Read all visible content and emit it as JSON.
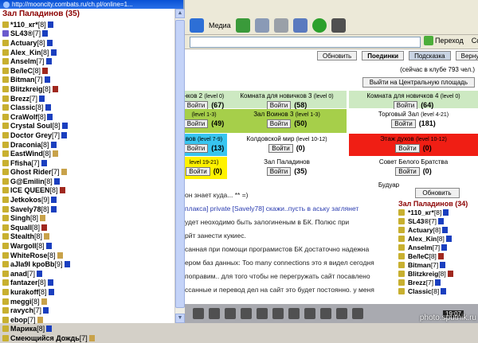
{
  "popup": {
    "url": "http://mooncity.combats.ru/ch.pl/online=1...",
    "heading": "Зал Паладинов (35)",
    "users": [
      {
        "nick": "*110_кг*",
        "level": "[8]",
        "align": "#c8b030",
        "icon": "#1a3fbf"
      },
      {
        "nick": "SL43®",
        "level": "[7]",
        "align": "#6a5acd",
        "icon": "#1a3fbf"
      },
      {
        "nick": "Actuary",
        "level": "[8]",
        "align": "#c8b030",
        "icon": "#1a3fbf"
      },
      {
        "nick": "Alex_Kin",
        "level": "[8]",
        "align": "#c8b030",
        "icon": "#1a3fbf"
      },
      {
        "nick": "Anselm",
        "level": "[7]",
        "align": "#c8b030",
        "icon": "#1a3fbf"
      },
      {
        "nick": "Be/IeC",
        "level": "[8]",
        "align": "#c8b030",
        "icon": "#a0281e"
      },
      {
        "nick": "Bitman",
        "level": "[7]",
        "align": "#c8b030",
        "icon": "#1a3fbf"
      },
      {
        "nick": "Blitzkreig",
        "level": "[8]",
        "align": "#c8b030",
        "icon": "#a0281e"
      },
      {
        "nick": "Brezz",
        "level": "[7]",
        "align": "#c8b030",
        "icon": "#1a3fbf"
      },
      {
        "nick": "Classic",
        "level": "[8]",
        "align": "#c8b030",
        "icon": "#1a3fbf"
      },
      {
        "nick": "CraWolf",
        "level": "[8]",
        "align": "#c8b030",
        "icon": "#1a3fbf"
      },
      {
        "nick": "Crystal Soul",
        "level": "[8]",
        "align": "#c8b030",
        "icon": "#1a3fbf"
      },
      {
        "nick": "Doctor Grey",
        "level": "[7]",
        "align": "#c8b030",
        "icon": "#1a3fbf"
      },
      {
        "nick": "Draconia",
        "level": "[8]",
        "align": "#c8b030",
        "icon": "#1a3fbf"
      },
      {
        "nick": "EastWind",
        "level": "[8]",
        "align": "#c8b030",
        "icon": "#c8a24a"
      },
      {
        "nick": "Ffisha",
        "level": "[7]",
        "align": "#c8b030",
        "icon": "#1a3fbf"
      },
      {
        "nick": "Ghost Rider",
        "level": "[7]",
        "align": "#c8b030",
        "icon": "#c8a24a"
      },
      {
        "nick": "G@Emilin",
        "level": "[8]",
        "align": "#c8b030",
        "icon": "#1a3fbf"
      },
      {
        "nick": "ICE QUEEN",
        "level": "[8]",
        "align": "#c8b030",
        "icon": "#a0281e"
      },
      {
        "nick": "Jetkokos",
        "level": "[9]",
        "align": "#c8b030",
        "icon": "#1a3fbf"
      },
      {
        "nick": "Savely78",
        "level": "[8]",
        "align": "#c8b030",
        "icon": "#1a3fbf"
      },
      {
        "nick": "Singh",
        "level": "[8]",
        "align": "#c8b030",
        "icon": "#c8a24a"
      },
      {
        "nick": "Squall",
        "level": "[8]",
        "align": "#c8b030",
        "icon": "#a0281e"
      },
      {
        "nick": "Stealth",
        "level": "[8]",
        "align": "#c8b030",
        "icon": "#c8a24a"
      },
      {
        "nick": "Wargoll",
        "level": "[8]",
        "align": "#c8b030",
        "icon": "#1a3fbf"
      },
      {
        "nick": "WhiteRose",
        "level": "[8]",
        "align": "#c8b030",
        "icon": "#c8a24a"
      },
      {
        "nick": "aJIa9I kpoBb",
        "level": "[9]",
        "align": "#c8b030",
        "icon": "#1a3fbf"
      },
      {
        "nick": "anad",
        "level": "[7]",
        "align": "#c8b030",
        "icon": "#1a3fbf"
      },
      {
        "nick": "fantazer",
        "level": "[8]",
        "align": "#c8b030",
        "icon": "#1a3fbf"
      },
      {
        "nick": "kurakoff",
        "level": "[8]",
        "align": "#c8b030",
        "icon": "#1a3fbf"
      },
      {
        "nick": "meggi",
        "level": "[8]",
        "align": "#c8b030",
        "icon": "#c8a24a"
      },
      {
        "nick": "ravych",
        "level": "[7]",
        "align": "#c8b030",
        "icon": "#1a3fbf"
      },
      {
        "nick": "ebop",
        "level": "[7]",
        "align": "#c8b030",
        "icon": "#c8a24a"
      },
      {
        "nick": "Марика",
        "level": "[8]",
        "align": "#c8b030",
        "icon": "#1a3fbf"
      },
      {
        "nick": "Смеющийся Дождь",
        "level": "[7]",
        "align": "#c8b030",
        "icon": "#c8a24a"
      }
    ]
  },
  "browser": {
    "media_label": "Медиа",
    "go_label": "Переход",
    "links_label": "Ссылк"
  },
  "game": {
    "buttons": {
      "refresh": "Обновить",
      "fights": "Поединки",
      "hint": "Подсказка",
      "back": "Вернуться"
    },
    "online_note": "(сейчас в клубе 793 чел.)",
    "exit_central": "Выйти на Центральную площадь",
    "enter_label": "Войти",
    "rooms": [
      {
        "name": "нков 2",
        "level": "(level 0)",
        "count": "(67)",
        "bg": "#cde9c2"
      },
      {
        "name": "Комната для новичков 3",
        "level": "(level 0)",
        "count": "(58)",
        "bg": "#cde9c2"
      },
      {
        "name": "Комната для новичков 4",
        "level": "(level 0)",
        "count": "(64)",
        "bg": "#cde9c2"
      },
      {
        "name": "",
        "level": "(level 1-3)",
        "count": "(49)",
        "bg": "#a6cf4a"
      },
      {
        "name": "Зал Воинов 3",
        "level": "(level 1-3)",
        "count": "(50)",
        "bg": "#a6cf4a"
      },
      {
        "name": "Торговый Зал",
        "level": "(level 4-21)",
        "count": "(181)",
        "bg": "#ffffff"
      },
      {
        "name": "вов",
        "level": "(level 7-9)",
        "count": "(13)",
        "bg": "#38c5f0"
      },
      {
        "name": "Колдовской мир",
        "level": "(level 10-12)",
        "count": "(0)",
        "bg": "#ffffff"
      },
      {
        "name": "Этаж духов",
        "level": "(level 10-12)",
        "count": "(0)",
        "bg": "#f01e14"
      },
      {
        "name": "",
        "level": "level 19-21)",
        "count": "(0)",
        "bg": "#fff200"
      },
      {
        "name": "Зал Паладинов",
        "level": "",
        "count": "(35)",
        "bg": "#ffffff"
      },
      {
        "name": "Совет Белого Братства",
        "level": "",
        "count": "(0)",
        "bg": "#ffffff"
      }
    ],
    "extra_label": "Будуар"
  },
  "chat": {
    "lines": [
      {
        "text": "он знает куда... ** =)",
        "cls": ""
      },
      {
        "text": "плакса] private [Savely78] скажи..пусть в аську заглянет",
        "cls": "blue"
      },
      {
        "text": "удет неоходимо быть залогиненым в БК. Полюс при",
        "cls": ""
      },
      {
        "text": "рйт занести кукиес.",
        "cls": ""
      },
      {
        "text": "санная при помощи програмистов БК достаточно надежна",
        "cls": ""
      },
      {
        "text": "ером баз данных: Too many connections это я видел сегодня",
        "cls": ""
      },
      {
        "text": "поправим.. для того чтобы не перегружать сайт посавлено",
        "cls": ""
      },
      {
        "text": "ссанные и перевод дел на сайт это будет постоянно. у меня",
        "cls": ""
      }
    ]
  },
  "right_list": {
    "refresh": "Обновить",
    "title": "Зал Паладинов (34)",
    "users": [
      {
        "nick": "*110_кг*",
        "level": "[8]",
        "icon": "#1a3fbf"
      },
      {
        "nick": "SL43®",
        "level": "[7]",
        "icon": "#1a3fbf"
      },
      {
        "nick": "Actuary",
        "level": "[8]",
        "icon": "#1a3fbf"
      },
      {
        "nick": "Alex_Kin",
        "level": "[8]",
        "icon": "#1a3fbf"
      },
      {
        "nick": "Anselm",
        "level": "[7]",
        "icon": "#1a3fbf"
      },
      {
        "nick": "Be/IeC",
        "level": "[8]",
        "icon": "#a0281e"
      },
      {
        "nick": "Bitman",
        "level": "[7]",
        "icon": "#1a3fbf"
      },
      {
        "nick": "Blitzkreig",
        "level": "[8]",
        "icon": "#a0281e"
      },
      {
        "nick": "Brezz",
        "level": "[7]",
        "icon": "#1a3fbf"
      },
      {
        "nick": "Classic",
        "level": "[8]",
        "icon": "#1a3fbf"
      }
    ]
  },
  "clock": "19:07",
  "watermark": "photo.sputnik.ru"
}
